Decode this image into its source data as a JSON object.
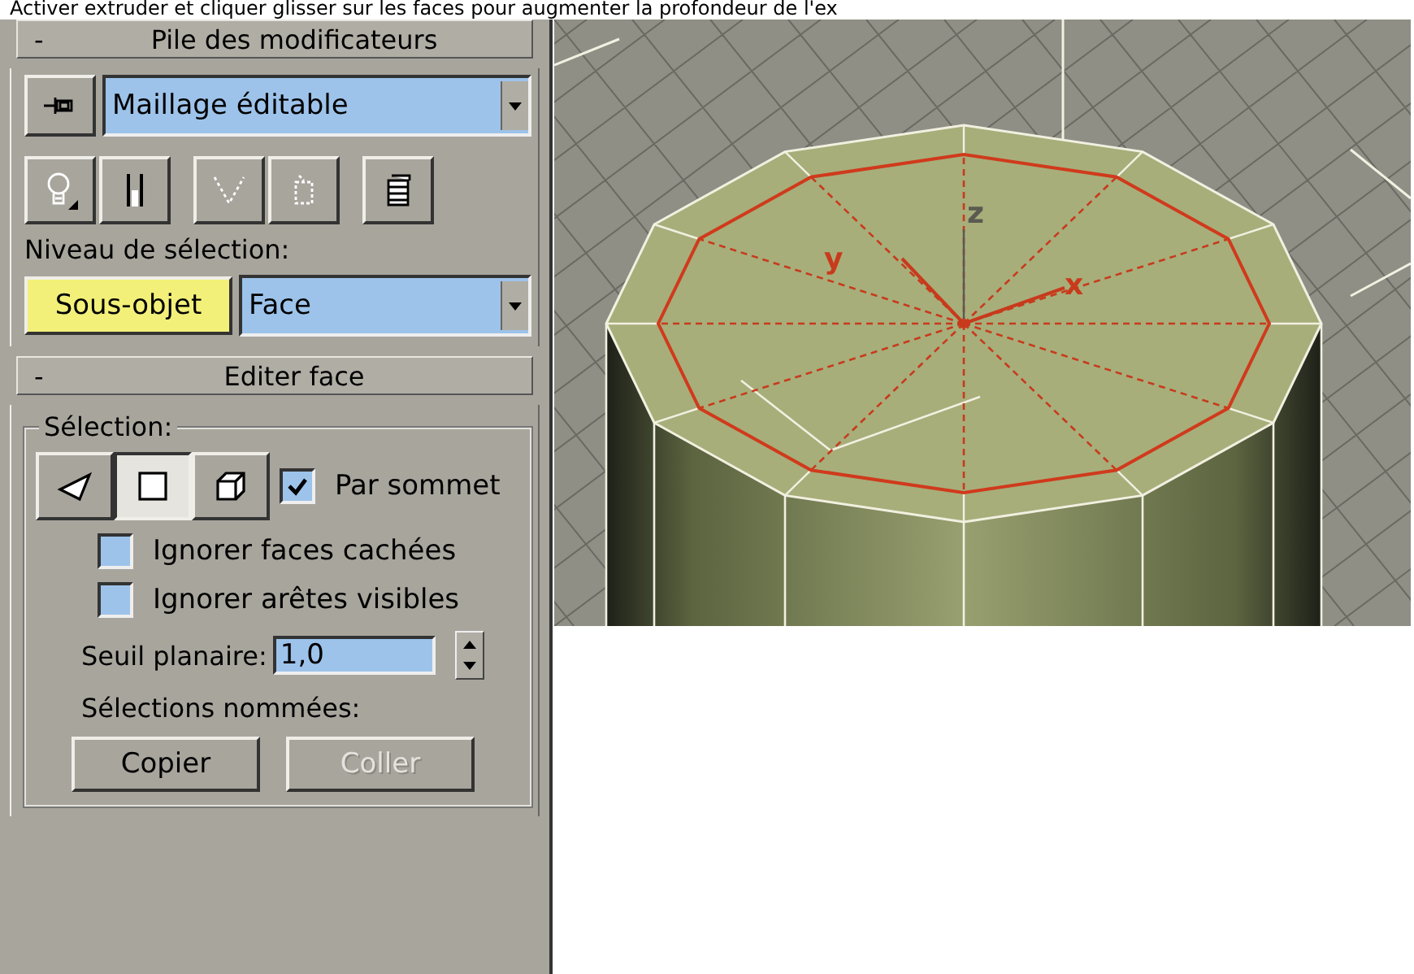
{
  "instruction": "Activer extruder et cliquer glisser sur les faces pour augmenter la profondeur de l'ex",
  "modifier_stack": {
    "collapse": "-",
    "title": "Pile des modificateurs",
    "modifier": "Maillage éditable",
    "selection_level_label": "Niveau de sélection:",
    "subobject": {
      "label": "Sous-objet",
      "on": true
    },
    "level": "Face"
  },
  "edit_face": {
    "collapse": "-",
    "title": "Editer face",
    "group": "Sélection:",
    "modes": [
      {
        "kind": "vertex",
        "selected": false
      },
      {
        "kind": "face",
        "selected": true
      },
      {
        "kind": "element",
        "selected": false
      }
    ],
    "by_vertex": {
      "label": "Par sommet",
      "checked": true
    },
    "options": [
      {
        "label": "Ignorer faces cachées",
        "checked": false
      },
      {
        "label": "Ignorer arêtes visibles",
        "checked": false
      }
    ],
    "planar": {
      "label": "Seuil planaire:",
      "value": "1,0"
    },
    "named_label": "Sélections nommées:",
    "buttons": [
      {
        "label": "Copier",
        "disabled": false
      },
      {
        "label": "Coller",
        "disabled": true
      }
    ]
  },
  "viewport": {
    "axis_labels": [
      "z",
      "y",
      "x"
    ]
  }
}
